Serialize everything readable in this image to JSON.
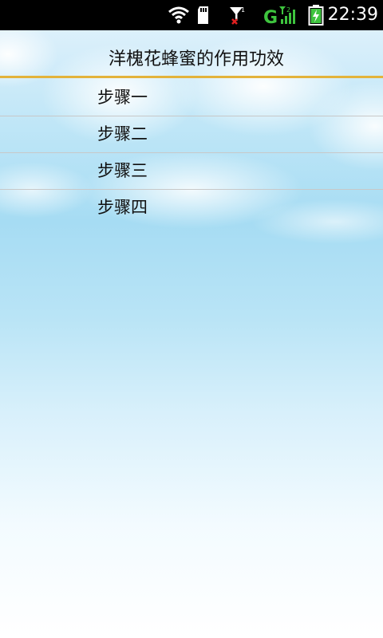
{
  "status_bar": {
    "time": "22:39",
    "icons": [
      "wifi-icon",
      "sd-card-icon",
      "no-signal-icon",
      "g-signal-icon",
      "battery-charging-icon"
    ],
    "colors": {
      "signal_green": "#3ec43e",
      "alert_red": "#e02020"
    }
  },
  "header": {
    "title": "洋槐花蜂蜜的作用功效",
    "accent_color": "#e3b33b"
  },
  "list": {
    "items": [
      {
        "label": "步骤一"
      },
      {
        "label": "步骤二"
      },
      {
        "label": "步骤三"
      },
      {
        "label": "步骤四"
      }
    ]
  }
}
